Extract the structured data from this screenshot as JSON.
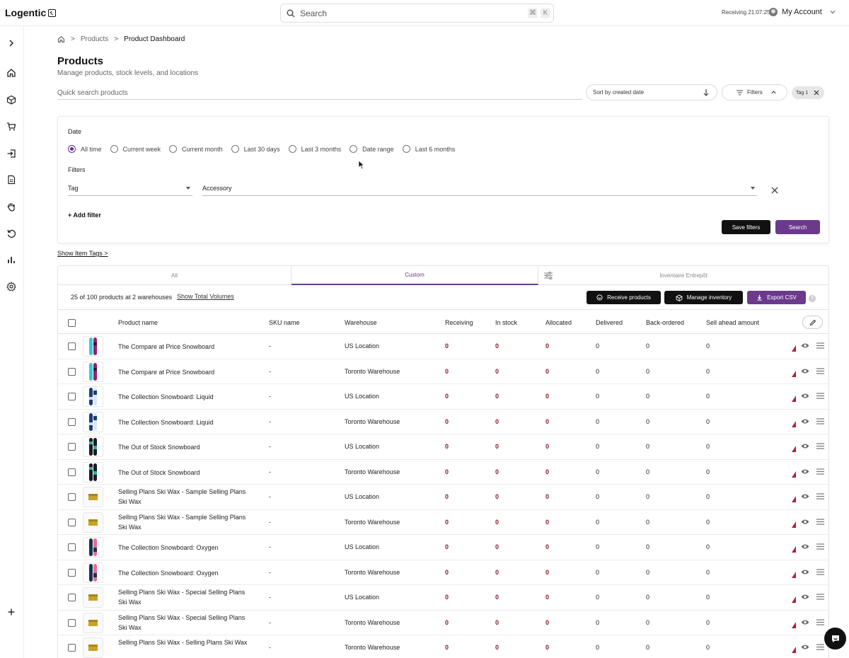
{
  "app": {
    "name": "Logentic"
  },
  "topbar": {
    "search_placeholder": "Search",
    "shortcut_1": "⌘",
    "shortcut_2": "K",
    "receiving_status": "Receiving 21:07:25",
    "account_label": "My Account"
  },
  "sidebar": {
    "items": [
      "expand",
      "home",
      "products",
      "orders",
      "receiving",
      "documents",
      "picking",
      "returns",
      "reports",
      "settings",
      "add"
    ]
  },
  "breadcrumb": {
    "level1": "Products",
    "current": "Product Dashboard"
  },
  "page": {
    "title": "Products",
    "subtitle": "Manage products, stock levels, and locations"
  },
  "controls": {
    "quick_search_placeholder": "Quick search products",
    "sort_label": "Sort by created date",
    "filters_label": "Filters",
    "tag_chip": "Tag 1"
  },
  "filter_panel": {
    "date_label": "Date",
    "date_options": [
      "All time",
      "Current week",
      "Current month",
      "Last 30 days",
      "Last 3 months",
      "Date range",
      "Last 6 months"
    ],
    "selected_date": "All time",
    "filters_label": "Filters",
    "filter_field": "Tag",
    "filter_value": "Accessory",
    "add_filter": "+ Add filter",
    "save_filters": "Save filters",
    "search": "Search"
  },
  "show_item_tags": "Show Item Tags >",
  "tabs": [
    {
      "label": "All"
    },
    {
      "label": "Custom"
    },
    {
      "label": "Inventaire Entrepôt"
    }
  ],
  "table_toolbar": {
    "count_text": "25 of 100 products at 2 warehouses",
    "show_volumes": "Show Total Volumes",
    "receive_products": "Receive products",
    "manage_inventory": "Manage inventory",
    "export_csv": "Export CSV",
    "help": "?"
  },
  "table": {
    "columns": [
      "Product name",
      "SKU name",
      "Warehouse",
      "Receiving",
      "In stock",
      "Allocated",
      "Delivered",
      "Back-ordered",
      "Sell ahead amount"
    ],
    "rows": [
      {
        "name": "The Compare at Price Snowboard",
        "sku": "-",
        "warehouse": "US Location",
        "receiving": "0",
        "in_stock": "0",
        "allocated": "0",
        "delivered": "0",
        "back_ordered": "0",
        "sell_ahead": "0",
        "thumb": "board-cyan"
      },
      {
        "name": "The Compare at Price Snowboard",
        "sku": "-",
        "warehouse": "Toronto Warehouse",
        "receiving": "0",
        "in_stock": "0",
        "allocated": "0",
        "delivered": "0",
        "back_ordered": "0",
        "sell_ahead": "0",
        "thumb": "board-cyan"
      },
      {
        "name": "The Collection Snowboard: Liquid",
        "sku": "-",
        "warehouse": "US Location",
        "receiving": "0",
        "in_stock": "0",
        "allocated": "0",
        "delivered": "0",
        "back_ordered": "0",
        "sell_ahead": "0",
        "thumb": "board-blue"
      },
      {
        "name": "The Collection Snowboard: Liquid",
        "sku": "-",
        "warehouse": "Toronto Warehouse",
        "receiving": "0",
        "in_stock": "0",
        "allocated": "0",
        "delivered": "0",
        "back_ordered": "0",
        "sell_ahead": "0",
        "thumb": "board-blue"
      },
      {
        "name": "The Out of Stock Snowboard",
        "sku": "-",
        "warehouse": "US Location",
        "receiving": "0",
        "in_stock": "0",
        "allocated": "0",
        "delivered": "0",
        "back_ordered": "0",
        "sell_ahead": "0",
        "thumb": "board-green"
      },
      {
        "name": "The Out of Stock Snowboard",
        "sku": "-",
        "warehouse": "Toronto Warehouse",
        "receiving": "0",
        "in_stock": "0",
        "allocated": "0",
        "delivered": "0",
        "back_ordered": "0",
        "sell_ahead": "0",
        "thumb": "board-green"
      },
      {
        "name": "Selling Plans Ski Wax - Sample Selling Plans Ski Wax",
        "sku": "-",
        "warehouse": "US Location",
        "receiving": "0",
        "in_stock": "0",
        "allocated": "0",
        "delivered": "0",
        "back_ordered": "0",
        "sell_ahead": "0",
        "thumb": "wax"
      },
      {
        "name": "Selling Plans Ski Wax - Sample Selling Plans Ski Wax",
        "sku": "-",
        "warehouse": "Toronto Warehouse",
        "receiving": "0",
        "in_stock": "0",
        "allocated": "0",
        "delivered": "0",
        "back_ordered": "0",
        "sell_ahead": "0",
        "thumb": "wax"
      },
      {
        "name": "The Collection Snowboard: Oxygen",
        "sku": "-",
        "warehouse": "US Location",
        "receiving": "0",
        "in_stock": "0",
        "allocated": "0",
        "delivered": "0",
        "back_ordered": "0",
        "sell_ahead": "0",
        "thumb": "board-pink"
      },
      {
        "name": "The Collection Snowboard: Oxygen",
        "sku": "-",
        "warehouse": "Toronto Warehouse",
        "receiving": "0",
        "in_stock": "0",
        "allocated": "0",
        "delivered": "0",
        "back_ordered": "0",
        "sell_ahead": "0",
        "thumb": "board-pink"
      },
      {
        "name": "Selling Plans Ski Wax - Special Selling Plans Ski Wax",
        "sku": "-",
        "warehouse": "US Location",
        "receiving": "0",
        "in_stock": "0",
        "allocated": "0",
        "delivered": "0",
        "back_ordered": "0",
        "sell_ahead": "0",
        "thumb": "wax"
      },
      {
        "name": "Selling Plans Ski Wax - Special Selling Plans Ski Wax",
        "sku": "-",
        "warehouse": "Toronto Warehouse",
        "receiving": "0",
        "in_stock": "0",
        "allocated": "0",
        "delivered": "0",
        "back_ordered": "0",
        "sell_ahead": "0",
        "thumb": "wax"
      },
      {
        "name": "Selling Plans Ski Wax - Selling Plans Ski Wax",
        "sku": "-",
        "warehouse": "Toronto Warehouse",
        "receiving": "0",
        "in_stock": "0",
        "allocated": "0",
        "delivered": "0",
        "back_ordered": "0",
        "sell_ahead": "0",
        "thumb": "wax"
      }
    ]
  },
  "colors": {
    "accent": "#6b3a8c",
    "dark_button": "#111111",
    "zero_value": "#8b1a2a",
    "flag": "#b3202f"
  }
}
